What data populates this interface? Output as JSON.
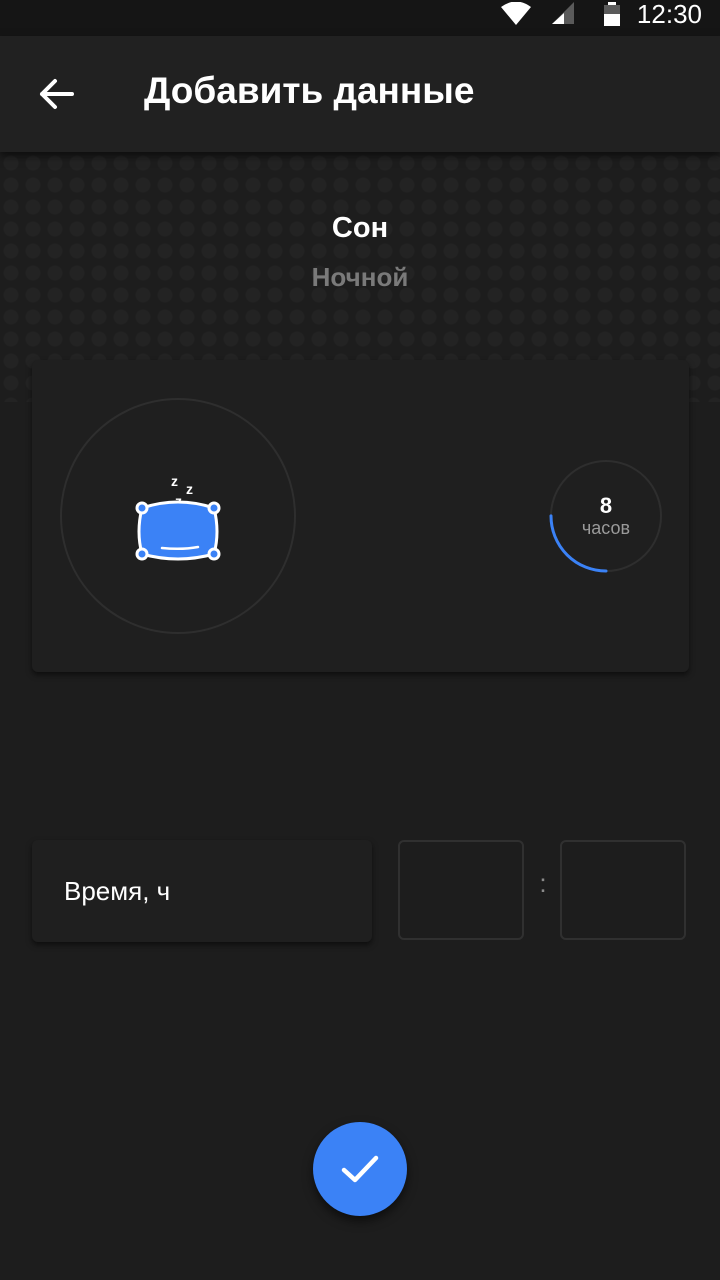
{
  "status_bar": {
    "time": "12:30",
    "icons": [
      "wifi-icon",
      "cell-signal-icon",
      "battery-icon"
    ]
  },
  "app_bar": {
    "title": "Добавить данные",
    "back_icon": "arrow-back-icon"
  },
  "activity": {
    "name": "Сон",
    "subtitle": "Ночной",
    "icon": "pillow-sleep-icon",
    "accent_color": "#3b82f6"
  },
  "goal": {
    "value": "8",
    "unit": "часов",
    "progress_fraction": 0.25
  },
  "time_entry": {
    "label": "Время, ч",
    "hours_value": "",
    "minutes_value": "",
    "separator": ":"
  },
  "fab": {
    "icon": "check-icon",
    "color": "#3b82f6"
  },
  "colors": {
    "background": "#1d1d1d",
    "app_bar": "#212121",
    "card": "#1f1f1f",
    "secondary_text": "#7a7a7a"
  }
}
